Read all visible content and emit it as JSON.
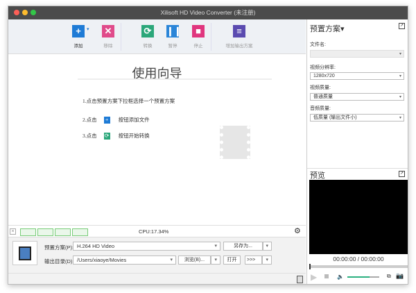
{
  "window": {
    "title": "Xilisoft HD Video Converter (未注册)"
  },
  "toolbar": {
    "add": "添加",
    "remove": "移除",
    "convert": "转换",
    "pause": "暂停",
    "stop": "停止",
    "add_profile": "增加输出方案"
  },
  "guide": {
    "title": "使用向导",
    "step1": "1.点击预置方案下拉框选择一个预置方案",
    "step2_pre": "2.点击",
    "step2_post": "按钮添加文件",
    "step3_pre": "3.点击",
    "step3_post": "按钮开始转换"
  },
  "status": {
    "cpu": "CPU:17.34%"
  },
  "bottom": {
    "profile_label": "预置方案(P):",
    "profile_value": "H.264 HD Video",
    "save_as": "另存为...",
    "output_label": "输出目录(D):",
    "output_value": "/Users/xiaoye/Movies",
    "browse": "浏览(B)...",
    "open": "打开",
    "transfer": ">>>"
  },
  "right": {
    "preset_title": "预置方案",
    "file_name_label": "文件名:",
    "file_name_value": "",
    "resolution_label": "视频分辨率:",
    "resolution_value": "1280x720",
    "video_quality_label": "视频质量:",
    "video_quality_value": "普通质量",
    "audio_quality_label": "音频质量:",
    "audio_quality_value": "低质量 (输出文件小)",
    "preview_title": "预览",
    "time": "00:00:00 / 00:00:00",
    "volume": 0.7,
    "seek": 0
  }
}
